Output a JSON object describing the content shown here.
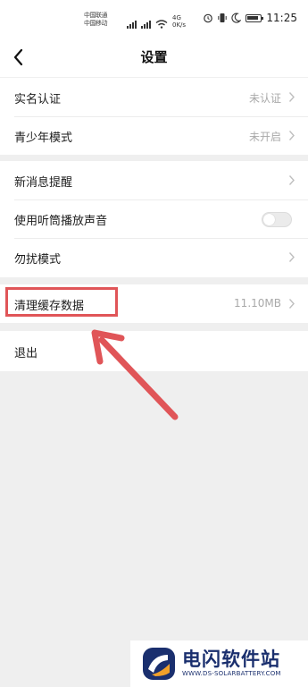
{
  "status_bar": {
    "carrier_line1": "中国联通",
    "carrier_line2": "中国移动",
    "network": "4G",
    "speed": "0K/s",
    "time": "11:25"
  },
  "nav": {
    "title": "设置"
  },
  "group1": [
    {
      "label": "实名认证",
      "value": "未认证"
    },
    {
      "label": "青少年模式",
      "value": "未开启"
    }
  ],
  "group2": {
    "notifications": {
      "label": "新消息提醒"
    },
    "earpiece": {
      "label": "使用听筒播放声音",
      "enabled": false
    },
    "dnd": {
      "label": "勿扰模式"
    }
  },
  "cache": {
    "label": "清理缓存数据",
    "value": "11.10MB"
  },
  "logout": {
    "label": "退出"
  },
  "colors": {
    "background": "#efefef",
    "highlight": "#e05558",
    "arrow": "#e05558",
    "watermark_blue": "#1a2f6e",
    "watermark_orange": "#f0a02a"
  },
  "watermark": {
    "title": "电闪软件站",
    "subtitle": "WWW.DS-SOLARBATTERY.COM"
  },
  "icons": {
    "back": "chevron-left-icon",
    "row_arrow": "chevron-right-icon",
    "wifi": "wifi-icon",
    "alarm": "alarm-icon",
    "vibrate": "vibrate-icon",
    "moon": "moon-icon",
    "battery": "battery-icon"
  }
}
